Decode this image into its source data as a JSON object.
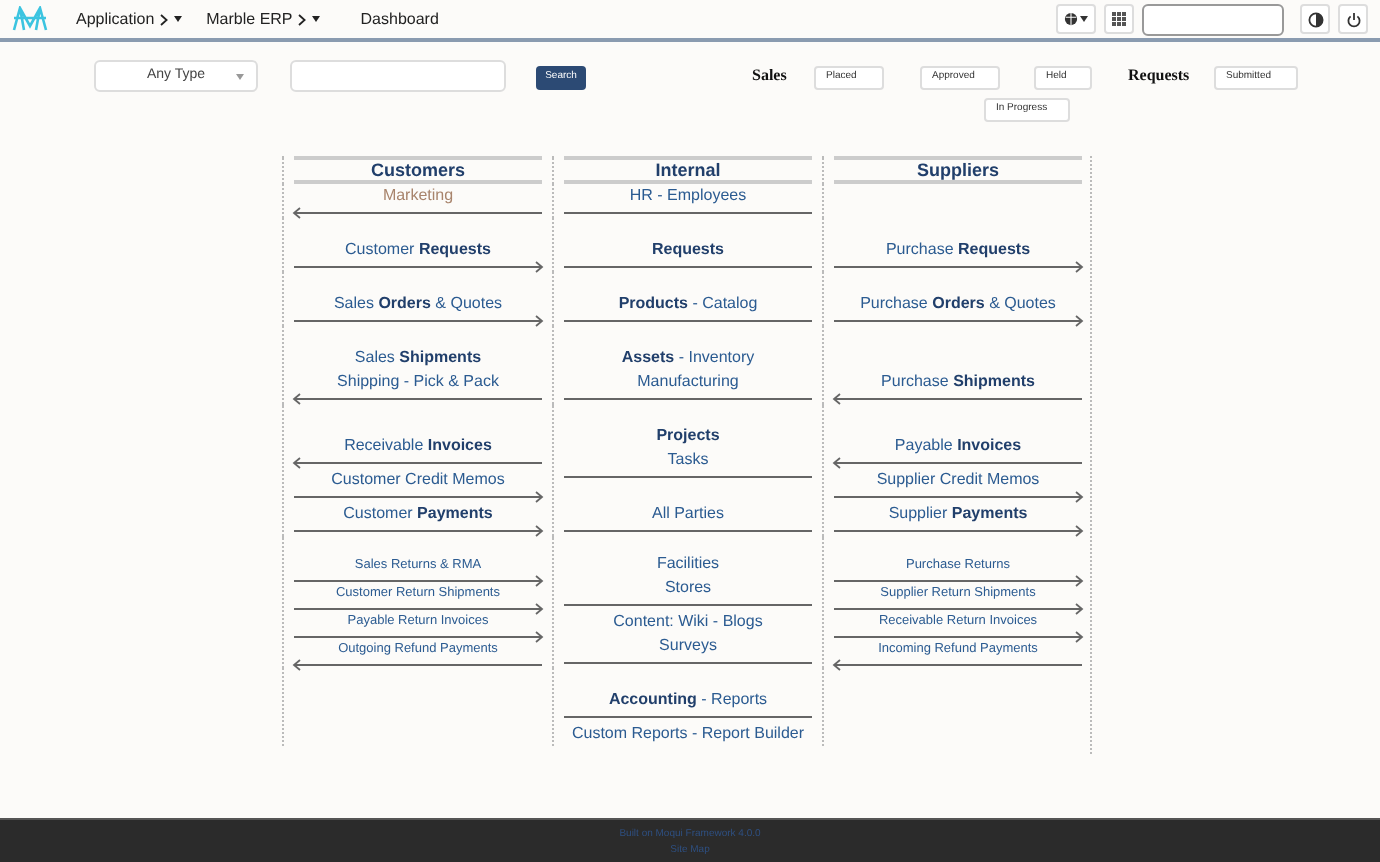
{
  "topbar": {
    "menus": [
      {
        "label": "Application"
      },
      {
        "label": "Marble ERP"
      }
    ],
    "page": "Dashboard"
  },
  "filters": {
    "type_select": "Any Type",
    "search_button": "Search",
    "groups": [
      {
        "title": "Sales",
        "buttons": [
          "Placed",
          "Approved",
          "Held",
          "In Progress"
        ]
      },
      {
        "title": "Requests",
        "buttons": [
          "Submitted"
        ]
      }
    ]
  },
  "columns": [
    "Customers",
    "Internal",
    "Suppliers"
  ],
  "rows": [
    {
      "cells": [
        [
          {
            "lines": [
              "Marketing"
            ],
            "spaced": false,
            "disabled": true,
            "kind": "link-left"
          }
        ],
        [
          {
            "lines": [
              "HR - Employees"
            ],
            "spaced": false,
            "disabled": false,
            "kind": "rule"
          }
        ],
        []
      ]
    },
    {
      "cells": [
        [
          {
            "lines": [
              "Customer **Requests**"
            ],
            "spaced": true,
            "disabled": false,
            "kind": "link-right"
          }
        ],
        [
          {
            "lines": [
              "**Requests**"
            ],
            "spaced": true,
            "disabled": false,
            "kind": "rule"
          }
        ],
        [
          {
            "lines": [
              "Purchase **Requests**"
            ],
            "spaced": true,
            "disabled": false,
            "kind": "link-right"
          }
        ]
      ]
    },
    {
      "cells": [
        [
          {
            "lines": [
              "Sales **Orders** & Quotes"
            ],
            "spaced": true,
            "disabled": false,
            "kind": "link-right"
          }
        ],
        [
          {
            "lines": [
              "**Products** - Catalog"
            ],
            "spaced": true,
            "disabled": false,
            "kind": "rule"
          }
        ],
        [
          {
            "lines": [
              "Purchase **Orders** & Quotes"
            ],
            "spaced": true,
            "disabled": false,
            "kind": "link-right"
          }
        ]
      ]
    },
    {
      "cells": [
        [
          {
            "lines": [
              "Sales **Shipments**",
              "Shipping - Pick & Pack"
            ],
            "spaced": true,
            "disabled": false,
            "kind": "link-left"
          }
        ],
        [
          {
            "lines": [
              "**Assets** - Inventory",
              "Manufacturing"
            ],
            "spaced": true,
            "disabled": false,
            "kind": "rule"
          }
        ],
        [
          {
            "lines": [
              "Purchase **Shipments**"
            ],
            "spaced": true,
            "disabled": false,
            "kind": "link-left"
          }
        ]
      ]
    },
    {
      "cells": [
        [
          {
            "lines": [
              "Receivable **Invoices**"
            ],
            "spaced": true,
            "disabled": false,
            "kind": "link-left"
          },
          {
            "lines": [
              "Customer Credit Memos"
            ],
            "spaced": false,
            "disabled": false,
            "kind": "link-right"
          },
          {
            "lines": [
              "Customer **Payments**"
            ],
            "spaced": false,
            "disabled": false,
            "kind": "link-right"
          }
        ],
        [
          {
            "lines": [
              "**Projects**",
              "Tasks"
            ],
            "spaced": true,
            "disabled": false,
            "kind": "rule"
          },
          {
            "lines": [
              "All Parties"
            ],
            "spaced": true,
            "disabled": false,
            "kind": "rule"
          }
        ],
        [
          {
            "lines": [
              "Payable **Invoices**"
            ],
            "spaced": true,
            "disabled": false,
            "kind": "link-left"
          },
          {
            "lines": [
              "Supplier Credit Memos"
            ],
            "spaced": false,
            "disabled": false,
            "kind": "link-right"
          },
          {
            "lines": [
              "Supplier **Payments**"
            ],
            "spaced": false,
            "disabled": false,
            "kind": "link-right"
          }
        ]
      ]
    },
    {
      "cells": [
        [
          {
            "lines": [
              "Sales Returns & RMA"
            ],
            "spaced": true,
            "disabled": false,
            "kind": "minor-right"
          },
          {
            "lines": [
              "Customer Return Shipments"
            ],
            "spaced": false,
            "disabled": false,
            "kind": "minor-right"
          },
          {
            "lines": [
              "Payable Return Invoices"
            ],
            "spaced": false,
            "disabled": false,
            "kind": "minor-right"
          },
          {
            "lines": [
              "Outgoing Refund Payments"
            ],
            "spaced": false,
            "disabled": false,
            "kind": "minor-left"
          }
        ],
        [
          {
            "lines": [
              "Facilities",
              "Stores"
            ],
            "spaced": false,
            "disabled": false,
            "kind": "rule"
          },
          {
            "lines": [
              "Content: Wiki - Blogs",
              "Surveys"
            ],
            "spaced": false,
            "disabled": false,
            "kind": "rule"
          }
        ],
        [
          {
            "lines": [
              "Purchase Returns"
            ],
            "spaced": true,
            "disabled": false,
            "kind": "minor-right"
          },
          {
            "lines": [
              "Supplier Return Shipments"
            ],
            "spaced": false,
            "disabled": false,
            "kind": "minor-right"
          },
          {
            "lines": [
              "Receivable Return Invoices"
            ],
            "spaced": false,
            "disabled": false,
            "kind": "minor-right"
          },
          {
            "lines": [
              "Incoming Refund Payments"
            ],
            "spaced": false,
            "disabled": false,
            "kind": "minor-left"
          }
        ]
      ]
    },
    {
      "cells": [
        [],
        [
          {
            "lines": [
              "**Accounting** - Reports"
            ],
            "spaced": true,
            "disabled": false,
            "kind": "rule"
          },
          {
            "lines": [
              "Custom Reports - Report Builder"
            ],
            "spaced": false,
            "disabled": false,
            "kind": "end"
          }
        ],
        []
      ]
    }
  ],
  "footer": {
    "lines": [
      "Built on Moqui Framework 4.0.0",
      "Site Map"
    ]
  }
}
